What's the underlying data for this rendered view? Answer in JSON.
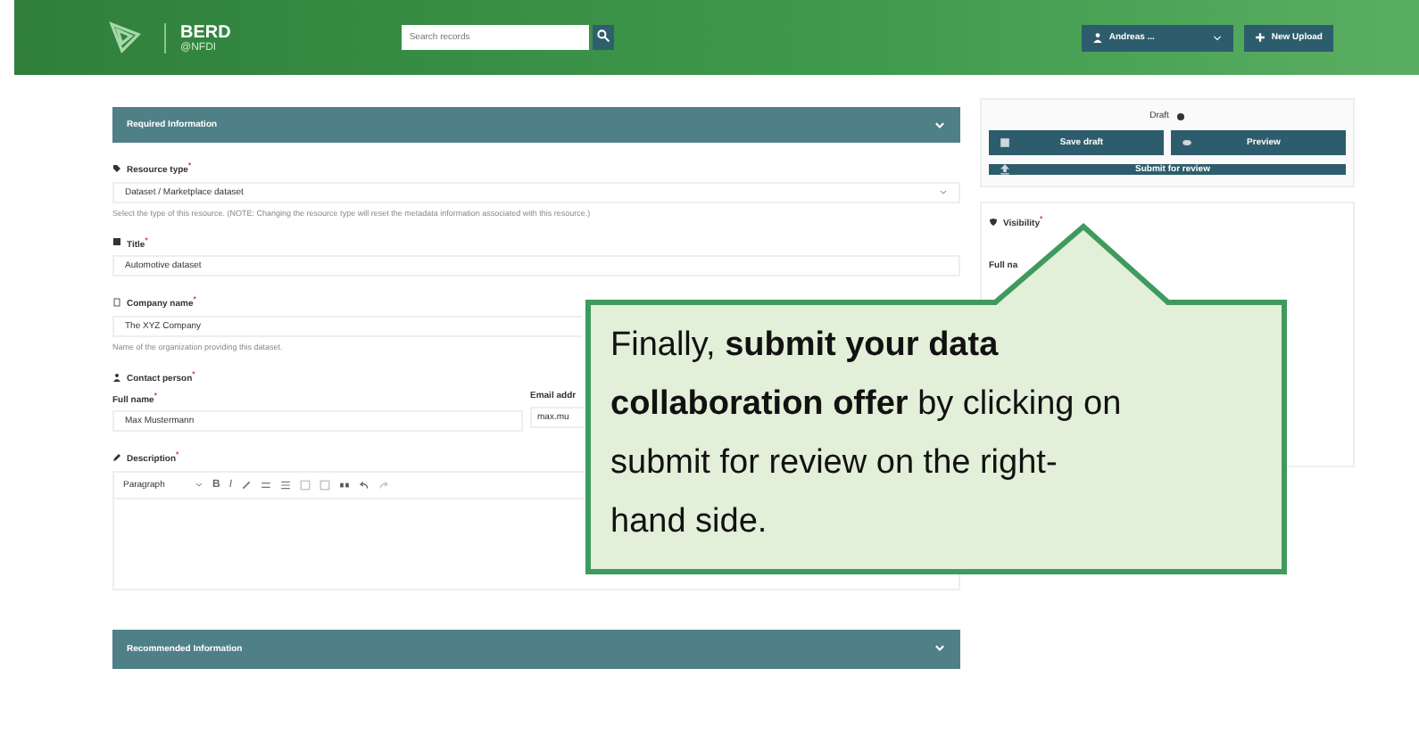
{
  "header": {
    "brand": "BERD",
    "subbrand": "@NFDI",
    "search": {
      "placeholder": "Search records"
    },
    "user_menu": "Andreas ...",
    "new_upload": "New Upload"
  },
  "required_section": {
    "title": "Required Information"
  },
  "resource_type": {
    "label": "Resource type$^{*}$",
    "value": "Dataset / Marketplace dataset",
    "help": "Select the type of this resource. (NOTE: Changing the resource type will reset the metadata information associated with this resource.)"
  },
  "title_field": {
    "label": "Title$^{*}$",
    "value": "Automotive dataset"
  },
  "company": {
    "label": "Company name$^{*}$",
    "value": "The XYZ Company",
    "help": "Name of the organization providing this dataset."
  },
  "contact": {
    "label": "Contact person$^{*}$",
    "full_name_label": "Full name$^{*}$",
    "full_name": "Max Mustermann",
    "email_label": "Email addr",
    "email": "max.mu"
  },
  "description": {
    "label": "Description$^{*}$",
    "format": "Paragraph",
    "bold": "B",
    "italic": "I"
  },
  "recommended_section": {
    "title": "Recommended Information"
  },
  "sidebar": {
    "status": "Draft",
    "save": "Save draft",
    "preview": "Preview",
    "submit": "Submit for review",
    "visibility": "Visibility$^{*}$",
    "visibility_sub": "Full na"
  },
  "callout": {
    "text": "Finally, **submit your data collaboration offer** by clicking on submit for review on the right-hand side."
  }
}
